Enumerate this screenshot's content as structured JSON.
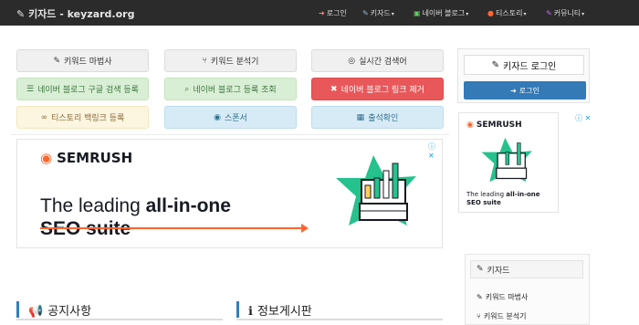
{
  "nav": {
    "brand": "키자드 - keyzard.org",
    "items": [
      {
        "icon": "login-icon",
        "glyph": "➜",
        "label": "로그인",
        "caret": ""
      },
      {
        "icon": "magic-wand-icon",
        "glyph": "✎",
        "label": "키자드",
        "caret": "▾"
      },
      {
        "icon": "naver-blog-icon",
        "glyph": "▣",
        "label": "네이버 블로그",
        "caret": "▾"
      },
      {
        "icon": "tistory-icon",
        "glyph": "●",
        "label": "티스토리",
        "caret": "▾"
      },
      {
        "icon": "community-icon",
        "glyph": "✎",
        "label": "커뮤니티",
        "caret": "▾"
      }
    ]
  },
  "buttons": [
    {
      "label": "키워드 마법사",
      "icon": "magic-wand-icon",
      "glyph": "✎"
    },
    {
      "label": "키워드 분석기",
      "icon": "fork-icon",
      "glyph": "⑂"
    },
    {
      "label": "실시간 검색어",
      "icon": "compass-icon",
      "glyph": "◎"
    },
    {
      "label": "네이버 블로그 구글 검색 등록",
      "icon": "database-icon",
      "glyph": "☰"
    },
    {
      "label": "네이버 블로그 등록 조회",
      "icon": "search-icon",
      "glyph": "⌕"
    },
    {
      "label": "네이버 블로그 링크 제거",
      "icon": "trash-icon",
      "glyph": "✖"
    },
    {
      "label": "티스토리 백링크 등록",
      "icon": "link-icon",
      "glyph": "∞"
    },
    {
      "label": "스폰서",
      "icon": "coins-icon",
      "glyph": "◉"
    },
    {
      "label": "출석확인",
      "icon": "calendar-check-icon",
      "glyph": "▦"
    }
  ],
  "ad": {
    "brand": "SEMRUSH",
    "headline_plain_1": "The leading ",
    "headline_bold_1": "all-in-one",
    "headline_bold_2": "SEO suite",
    "close_glyph": "ⓘ ✕",
    "accent": "#ff642d"
  },
  "ad_small": {
    "brand": "SEMRUSH",
    "headline_plain": "The leading ",
    "headline_bold_1": "all-in-one",
    "headline_bold_2": "SEO suite"
  },
  "sections": [
    {
      "label": "공지사항",
      "icon": "megaphone-icon",
      "glyph": "📢"
    },
    {
      "label": "정보게시판",
      "icon": "info-icon",
      "glyph": "ℹ"
    }
  ],
  "login": {
    "title": "키자드 로그인",
    "button": "로그인"
  },
  "menu": {
    "head": "키자드",
    "items": [
      "키워드 마법사",
      "키워드 분석기"
    ]
  },
  "colors": {
    "navbar": "#2b2b2b",
    "primary": "#337ab7",
    "section_accent": "#2f7fc0"
  }
}
